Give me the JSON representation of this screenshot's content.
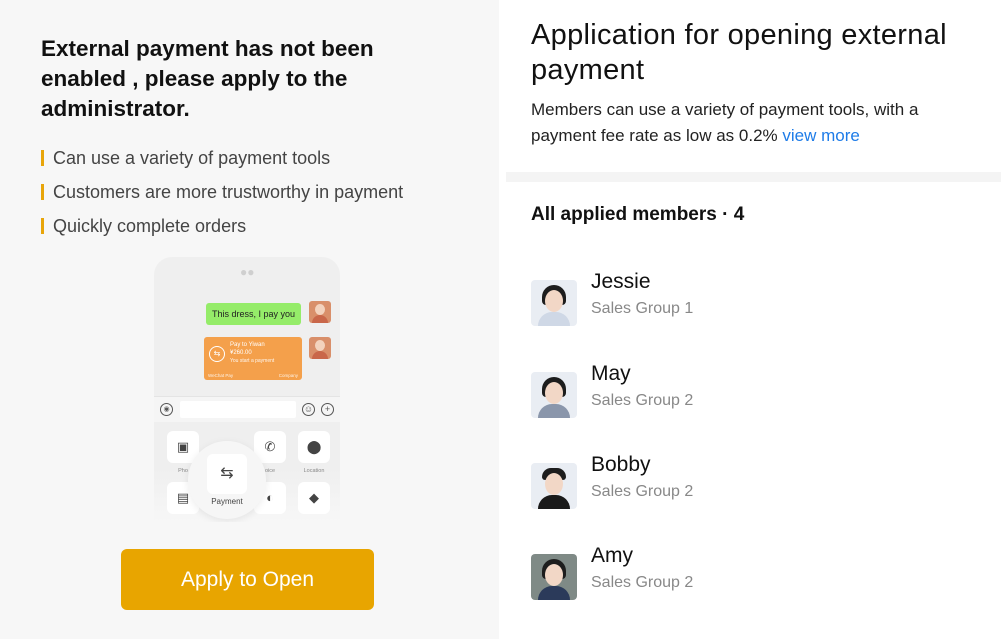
{
  "left": {
    "notice_title": "External payment has not been enabled , please apply to the administrator.",
    "benefits": [
      "Can use a variety of payment tools",
      "Customers are more trustworthy in payment",
      "Quickly complete orders"
    ],
    "phone": {
      "chat_message": "This dress, I pay you",
      "pay_card": {
        "line1": "Pay to Yiwan",
        "amount": "¥260.00",
        "line3": "You start a payment",
        "footer_left": "WeChat Pay",
        "footer_right": "Company"
      },
      "tiles": [
        {
          "icon": "photo-icon",
          "label": "Pho"
        },
        {
          "icon": "phone-icon",
          "label": "oice"
        },
        {
          "icon": "location-icon",
          "label": "Location"
        }
      ],
      "payment_label": "Payment"
    },
    "apply_button": "Apply to Open",
    "accent_color": "#e8a500"
  },
  "right": {
    "title": "Application for opening external payment",
    "description": "Members can use a variety of payment tools, with a payment fee rate as low as 0.2%",
    "view_more": "view more",
    "members_heading": "All applied members · 4",
    "members": [
      {
        "name": "Jessie",
        "group": "Sales Group 1"
      },
      {
        "name": "May",
        "group": "Sales Group 2"
      },
      {
        "name": "Bobby",
        "group": "Sales Group 2"
      },
      {
        "name": "Amy",
        "group": "Sales Group 2"
      }
    ]
  }
}
